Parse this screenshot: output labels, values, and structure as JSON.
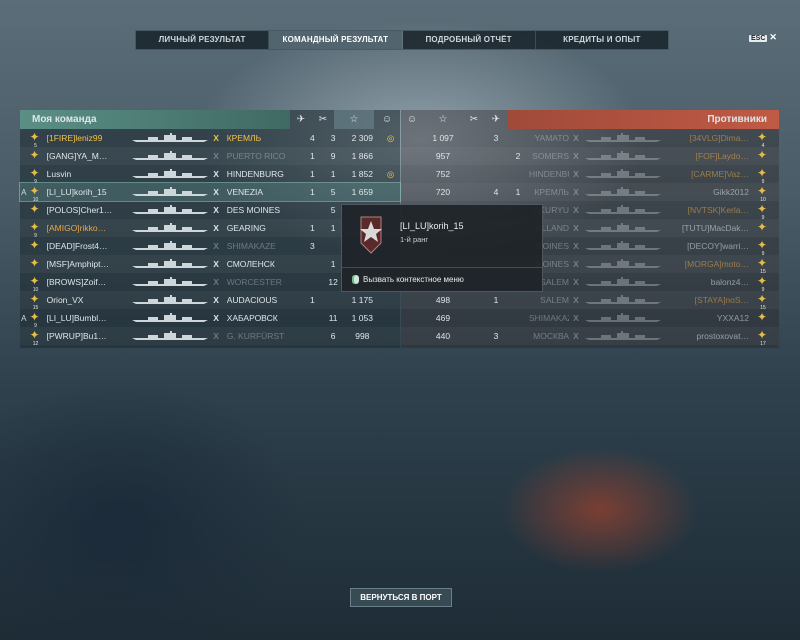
{
  "tabs": [
    "ЛИЧНЫЙ РЕЗУЛЬТАТ",
    "КОМАНДНЫЙ РЕЗУЛЬТАТ",
    "ПОДРОБНЫЙ ОТЧЁТ",
    "КРЕДИТЫ И ОПЫТ"
  ],
  "active_tab": 1,
  "esc": {
    "key": "ESC",
    "close": "✕"
  },
  "my_team": {
    "title": "Моя команда",
    "columns": [
      "plane-icon",
      "crossed-swords-icon",
      "star-icon",
      "laurel-icon"
    ],
    "rows": [
      {
        "rank": "5",
        "player": "[1FIRE]leniz99",
        "tier": "X",
        "ship": "КРЕМЛЬ",
        "c1": "4",
        "c2": "3",
        "xp": "2 309",
        "badge": "◎",
        "highlight": "gold",
        "dim": false
      },
      {
        "rank": "",
        "player": "[GANG]YA_M…",
        "tier": "X",
        "ship": "PUERTO RICO",
        "c1": "1",
        "c2": "9",
        "xp": "1 866",
        "badge": "",
        "highlight": "",
        "dim": true
      },
      {
        "rank": "9",
        "player": "Lusvin",
        "tier": "X",
        "ship": "HINDENBURG",
        "c1": "1",
        "c2": "1",
        "xp": "1 852",
        "badge": "◎",
        "highlight": "",
        "dim": false
      },
      {
        "rank": "10",
        "player": "[LI_LU]korih_15",
        "tier": "X",
        "ship": "VENEZIA",
        "c1": "1",
        "c2": "5",
        "xp": "1 659",
        "badge": "",
        "highlight": "",
        "dim": false,
        "selected": true
      },
      {
        "rank": "",
        "player": "[POLOS]Cher1…",
        "tier": "X",
        "ship": "DES MOINES",
        "c1": "",
        "c2": "5",
        "xp": "",
        "badge": "",
        "highlight": "",
        "dim": false
      },
      {
        "rank": "9",
        "player": "[AMIGO]rikko…",
        "tier": "X",
        "ship": "GEARING",
        "c1": "1",
        "c2": "1",
        "xp": "",
        "badge": "",
        "highlight": "orange",
        "dim": false
      },
      {
        "rank": "",
        "player": "[DEAD]Frost4…",
        "tier": "X",
        "ship": "SHIMAKAZE",
        "c1": "3",
        "c2": "",
        "xp": "",
        "badge": "",
        "highlight": "",
        "dim": true
      },
      {
        "rank": "",
        "player": "[MSF]Amphipt…",
        "tier": "X",
        "ship": "СМОЛЕНСК",
        "c1": "",
        "c2": "1",
        "xp": "",
        "badge": "",
        "highlight": "",
        "dim": false
      },
      {
        "rank": "10",
        "player": "[BROWS]Zoif…",
        "tier": "X",
        "ship": "WORCESTER",
        "c1": "",
        "c2": "12",
        "xp": "",
        "badge": "",
        "highlight": "",
        "dim": true
      },
      {
        "rank": "15",
        "player": "Orion_VX",
        "tier": "X",
        "ship": "AUDACIOUS",
        "c1": "1",
        "c2": "",
        "xp": "1 175",
        "badge": "",
        "highlight": "",
        "dim": false
      },
      {
        "rank": "9",
        "player": "[LI_LU]Bumbl…",
        "tier": "X",
        "ship": "ХАБАРОВСК",
        "c1": "",
        "c2": "11",
        "xp": "1 053",
        "badge": "",
        "highlight": "",
        "dim": false
      },
      {
        "rank": "12",
        "player": "[PWRUP]Bu1…",
        "tier": "X",
        "ship": "G. KURFÜRST",
        "c1": "",
        "c2": "6",
        "xp": "998",
        "badge": "",
        "highlight": "",
        "dim": true
      }
    ]
  },
  "enemy_team": {
    "title": "Противники",
    "columns": [
      "laurel-icon",
      "star-icon",
      "crossed-swords-icon",
      "plane-icon"
    ],
    "rows": [
      {
        "xp": "1 097",
        "c1": "3",
        "c2": "",
        "ship": "YAMATO",
        "tier": "X",
        "player": "[34VLG]Dima…",
        "rank": "4",
        "dim": true,
        "tag_color": "orange"
      },
      {
        "xp": "957",
        "c1": "",
        "c2": "2",
        "ship": "SOMERS",
        "tier": "X",
        "player": "[FOF]Laydo…",
        "rank": "",
        "dim": true,
        "tag_color": "orange"
      },
      {
        "xp": "752",
        "c1": "",
        "c2": "",
        "ship": "HINDENBURG",
        "tier": "X",
        "player": "[CARME]Vaz…",
        "rank": "9",
        "dim": true,
        "tag_color": "orange"
      },
      {
        "xp": "720",
        "c1": "4",
        "c2": "1",
        "ship": "КРЕМЛЬ",
        "tier": "X",
        "player": "Gikk2012",
        "rank": "10",
        "dim": true,
        "tag_color": ""
      },
      {
        "xp": "",
        "c1": "",
        "c2": "",
        "ship": "AKURYU",
        "tier": "X",
        "player": "[NVTSK]Kerla…",
        "rank": "9",
        "dim": true,
        "tag_color": "orange"
      },
      {
        "xp": "",
        "c1": "",
        "c2": "",
        "ship": "ALLAND",
        "tier": "X",
        "player": "[TUTU]MacDak…",
        "rank": "",
        "dim": true,
        "tag_color": ""
      },
      {
        "xp": "",
        "c1": "",
        "c2": "",
        "ship": "MOINES",
        "tier": "X",
        "player": "[DECOY]warri…",
        "rank": "9",
        "dim": true,
        "tag_color": ""
      },
      {
        "xp": "",
        "c1": "",
        "c2": "",
        "ship": "MOINES",
        "tier": "X",
        "player": "[MORGA]moto…",
        "rank": "15",
        "dim": true,
        "tag_color": "orange"
      },
      {
        "xp": "",
        "c1": "",
        "c2": "",
        "ship": "SALEM",
        "tier": "X",
        "player": "balonz4…",
        "rank": "9",
        "dim": true,
        "tag_color": ""
      },
      {
        "xp": "498",
        "c1": "1",
        "c2": "",
        "ship": "SALEM",
        "tier": "X",
        "player": "[STAYA]noS…",
        "rank": "15",
        "dim": true,
        "tag_color": "orange"
      },
      {
        "xp": "469",
        "c1": "",
        "c2": "",
        "ship": "SHIMAKAZE",
        "tier": "X",
        "player": "YXXA12",
        "rank": "",
        "dim": true,
        "tag_color": ""
      },
      {
        "xp": "440",
        "c1": "3",
        "c2": "",
        "ship": "МОСКВА",
        "tier": "X",
        "player": "prostoxovat…",
        "rank": "17",
        "dim": true,
        "tag_color": ""
      }
    ]
  },
  "tooltip": {
    "player": "[LI_LU]korih_15",
    "rank": "1-й ранг",
    "action": "Вызвать контекстное меню"
  },
  "back_button": "ВЕРНУТЬСЯ В ПОРТ"
}
